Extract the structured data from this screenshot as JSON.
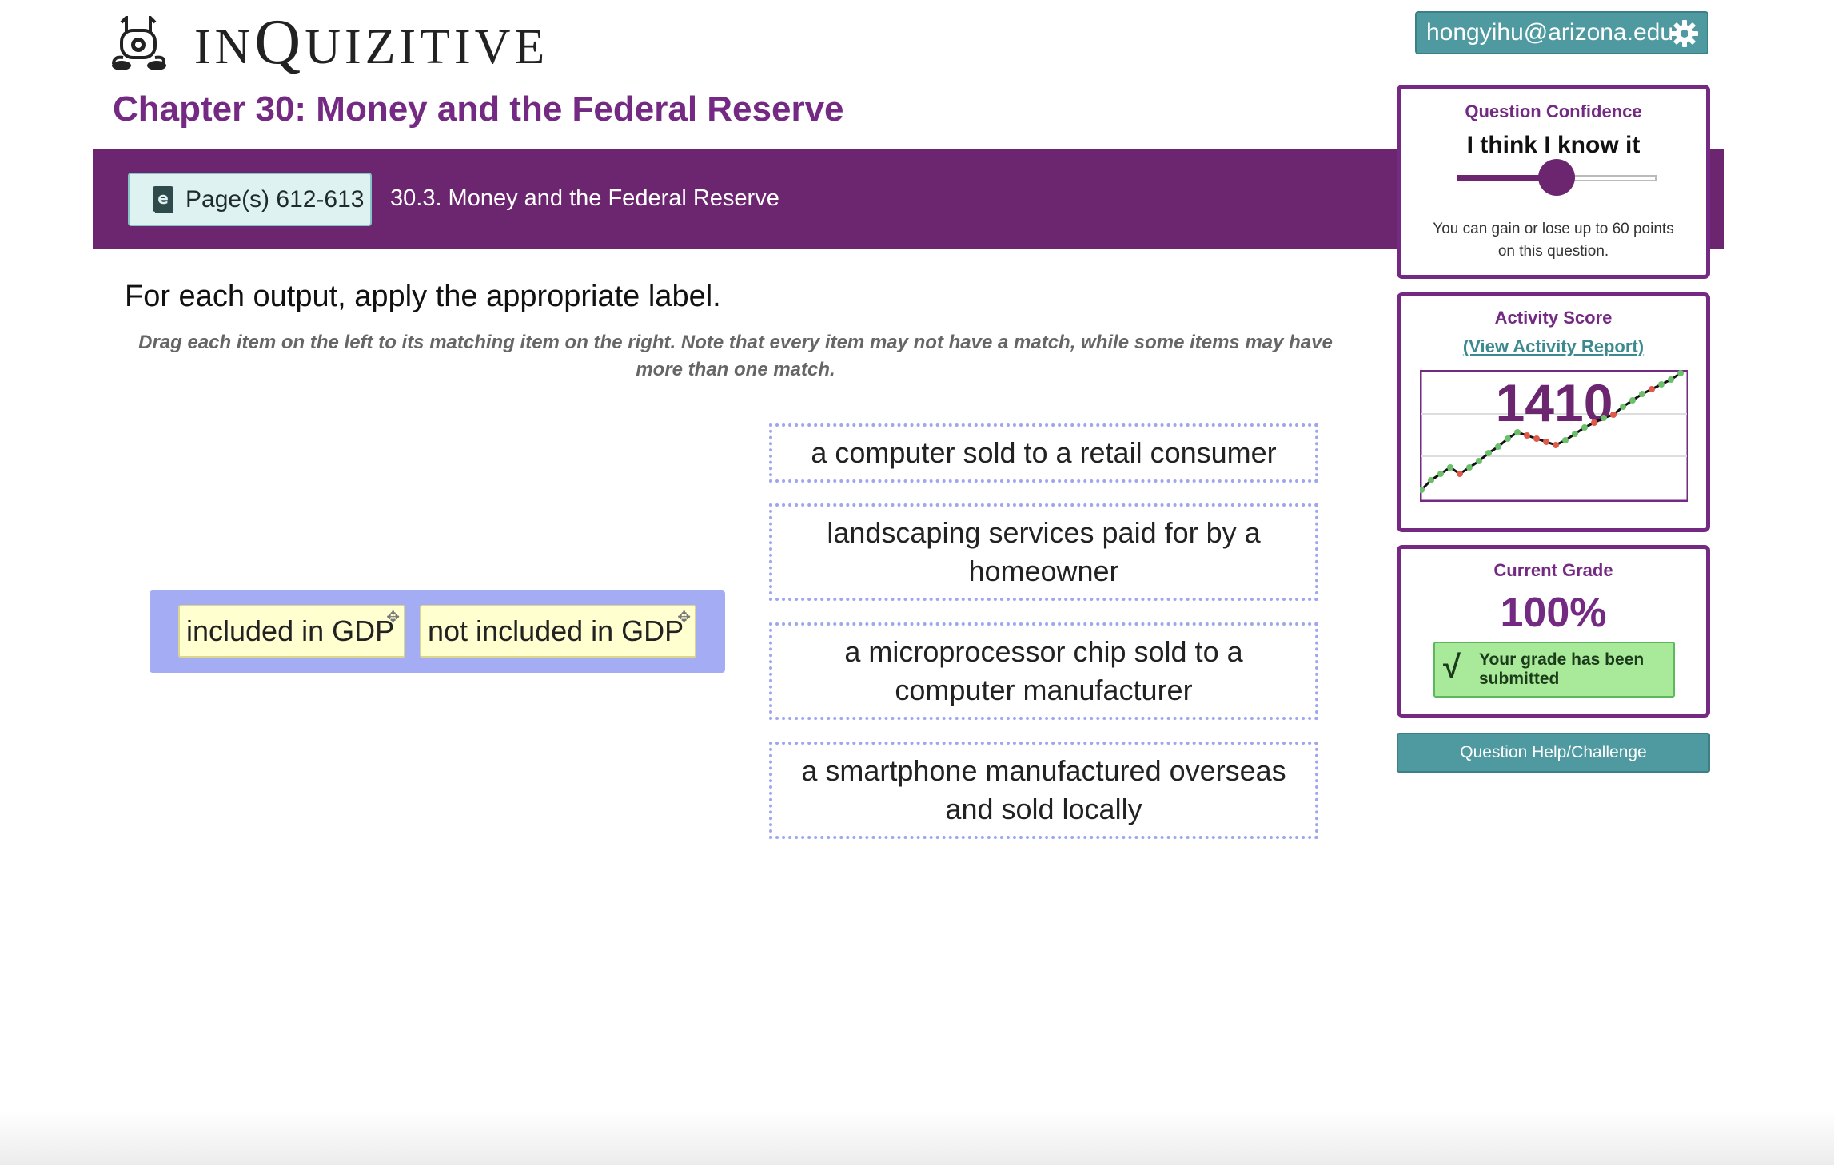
{
  "header": {
    "brand": "INQUIZITIVE",
    "user_email": "hongyihu@arizona.edu",
    "chapter_title": "Chapter 30: Money and the Federal Reserve"
  },
  "section_bar": {
    "pages_label": "Page(s) 612-613",
    "section_label": "30.3. Money and the Federal Reserve"
  },
  "question": {
    "prompt": "For each output, apply the appropriate label.",
    "instructions": "Drag each item on the left to its matching item on the right. Note that every item may not have a match, while some items may have more than one match.",
    "labels": [
      "included in GDP",
      "not included in GDP"
    ],
    "targets": [
      "a computer sold to a retail consumer",
      "landscaping services paid for by a homeowner",
      "a microprocessor chip sold to a computer manufacturer",
      "a smartphone manufactured overseas and sold locally"
    ]
  },
  "confidence": {
    "title": "Question Confidence",
    "value": "I think I know it",
    "level_fraction": 0.5,
    "note": "You can gain or lose up to 60 points on this question."
  },
  "activity": {
    "title": "Activity Score",
    "link": "(View Activity Report)",
    "score": "1410"
  },
  "grade": {
    "title": "Current Grade",
    "value": "100%",
    "badge": "Your grade has been submitted"
  },
  "help_button": "Question Help/Challenge",
  "colors": {
    "brand_purple": "#742a82",
    "teal": "#4e9aa0",
    "tray": "#a4adf4",
    "chip": "#ffffd0",
    "success": "#a8ea9a"
  }
}
